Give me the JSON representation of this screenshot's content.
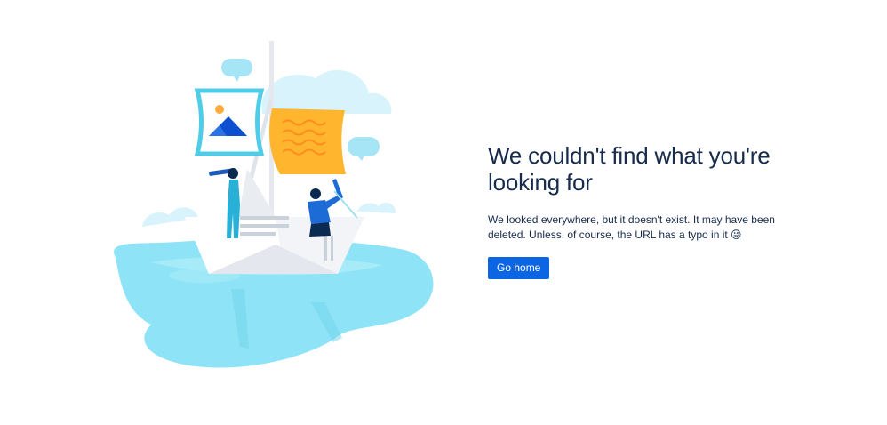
{
  "error": {
    "heading": "We couldn't find what you're looking for",
    "message": "We looked everywhere, but it doesn't exist. It may have been deleted. Unless, of course, the URL has a typo in it 😜",
    "button_label": "Go home"
  },
  "colors": {
    "primary_button": "#0c66e4",
    "text": "#172b4d",
    "water": "#8fe3f5",
    "sail": "#ffb020"
  }
}
